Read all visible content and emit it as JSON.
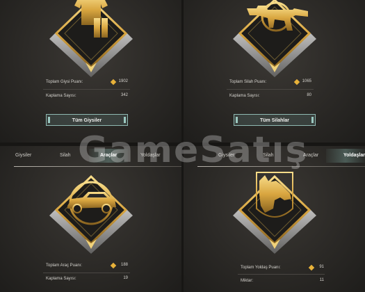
{
  "panel1": {
    "stat1": {
      "label": "Toplam Giysi Puanı:",
      "value": "1902"
    },
    "stat2": {
      "label": "Kaplama Sayısı:",
      "value": "342"
    },
    "button": "Tüm Giysiler"
  },
  "panel2": {
    "stat1": {
      "label": "Toplam Silah Puanı:",
      "value": "1065"
    },
    "stat2": {
      "label": "Kaplama Sayısı:",
      "value": "80"
    },
    "button": "Tüm Silahlar"
  },
  "panel3": {
    "tabs": [
      "Giysiler",
      "Silah",
      "Araçlar",
      "Yoldaşlar"
    ],
    "active_tab": "Araçlar",
    "stat1": {
      "label": "Toplam Araç Puanı:",
      "value": "188"
    },
    "stat2": {
      "label": "Kaplama Sayısı:",
      "value": "19"
    }
  },
  "panel4": {
    "tabs": [
      "Giysiler",
      "Silah",
      "Araçlar",
      "Yoldaşlar"
    ],
    "active_tab": "Yoldaşlar",
    "stat1": {
      "label": "Toplam Yoldaş Puanı:",
      "value": "91"
    },
    "stat2": {
      "label": "Miktar:",
      "value": "11"
    }
  },
  "watermark": "GameSatış",
  "icons": [
    "clothing-icon",
    "rifle-icon",
    "car-icon",
    "wolf-icon",
    "currency-diamond-icon"
  ],
  "colors": {
    "gold": "#e8b23a",
    "accent": "#8fb9b2",
    "background": "#2b2926"
  }
}
